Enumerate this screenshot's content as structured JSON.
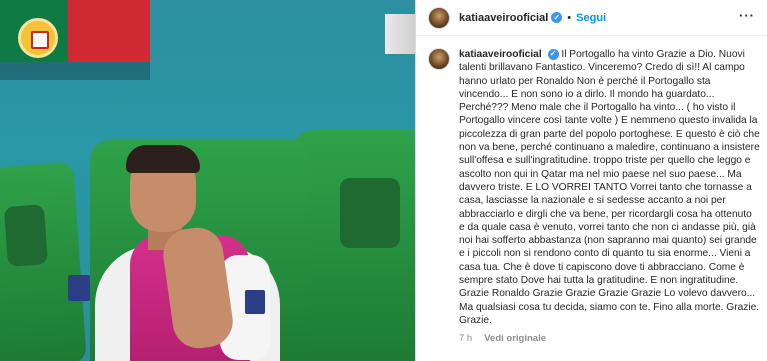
{
  "post": {
    "username": "katiaaveirooficial",
    "verified_glyph": "✓",
    "dot": "•",
    "follow_label": "Segui",
    "more_icon": "more-options-icon",
    "caption": "Il Portogallo ha vinto Grazie a Dio. Nuovi talenti brillavano Fantastico. Vinceremo? Credo di sì!! Al campo hanno urlato per Ronaldo Non è perché il Portogallo sta vincendo... E non sono io a dirlo. Il mondo ha guardato... Perché??? Meno male che il Portogallo ha vinto... ( ho visto il Portogallo vincere così tante volte ) E nemmeno questo invalida la piccolezza di gran parte del popolo portoghese. E questo è ciò che non va bene, perché continuano a maledire, continuano a insistere sull'offesa e sull'ingratitudine. troppo triste per quello che leggo e ascolto non qui in Qatar ma nel mio paese nel suo paese... Ma davvero triste. E LO VORREI TANTO Vorrei tanto che tornasse a casa, lasciasse la nazionale e si sedesse accanto a noi per abbracciarlo e dirgli che va bene, per ricordargli cosa ha ottenuto e da quale casa è venuto, vorrei tanto che non ci andasse più, già noi hai sofferto abbastanza (non sapranno mai quanto) sei grande e i piccoli non si rendono conto di quanto tu sia enorme... Vieni a casa tua. Che è dove ti capiscono dove ti abbracciano. Come è sempre stato Dove hai tutta la gratitudine. E non ingratitudine. Grazie Ronaldo Grazie Grazie Grazie Grazie Lo volevo davvero... Ma qualsiasi cosa tu decida, siamo con te. Fino alla morte. Grazie. Grazie.",
    "timestamp": "7 h",
    "see_translation": "Vedi originale"
  },
  "colors": {
    "link_blue": "#0095f6",
    "verified_blue": "#3897f0",
    "text": "#262626",
    "muted": "#8e8e8e"
  }
}
